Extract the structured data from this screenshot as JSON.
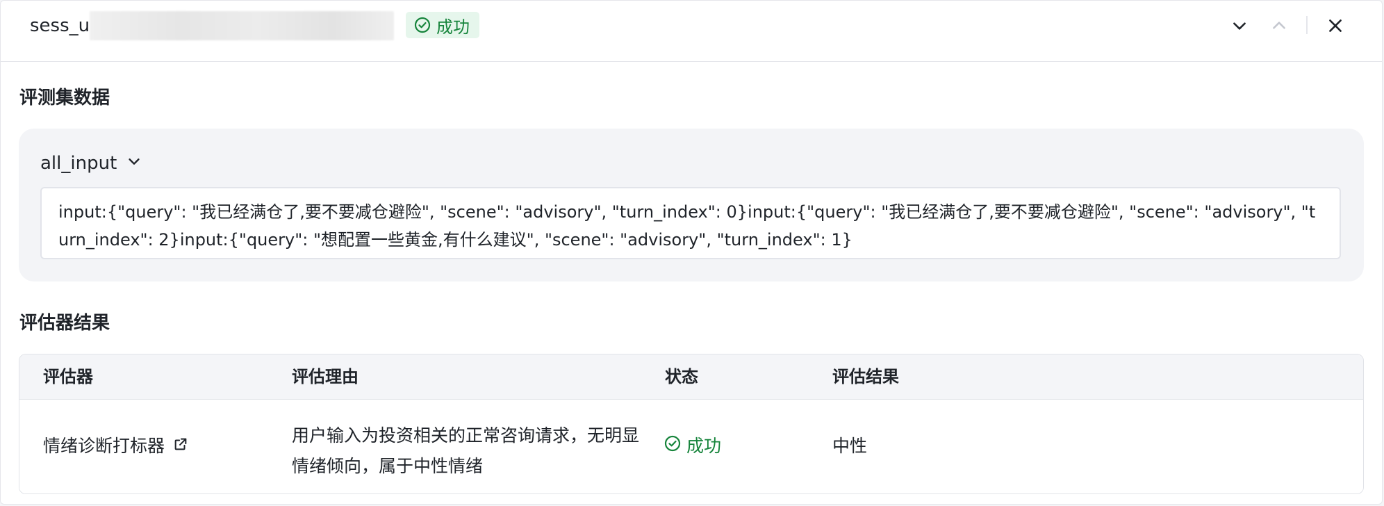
{
  "header": {
    "session_id_prefix": "sess_u",
    "status_badge": "成功",
    "icons": [
      "chevron-down-icon",
      "chevron-up-icon",
      "close-icon"
    ]
  },
  "dataset": {
    "section_title": "评测集数据",
    "field_name": "all_input",
    "field_value": "input:{\"query\": \"我已经满仓了,要不要减仓避险\", \"scene\": \"advisory\", \"turn_index\": 0}input:{\"query\": \"我已经满仓了,要不要减仓避险\", \"scene\": \"advisory\", \"turn_index\": 2}input:{\"query\": \"想配置一些黄金,有什么建议\", \"scene\": \"advisory\", \"turn_index\": 1}"
  },
  "results": {
    "section_title": "评估器结果",
    "columns": [
      "评估器",
      "评估理由",
      "状态",
      "评估结果"
    ],
    "rows": [
      {
        "evaluator": "情绪诊断打标器",
        "reason": "用户输入为投资相关的正常咨询请求，无明显情绪倾向，属于中性情绪",
        "status": "成功",
        "result": "中性"
      }
    ]
  },
  "colors": {
    "success": "#16843b",
    "success_bg": "#e6f6ec",
    "card_bg": "#f3f4f7",
    "border": "#e5e6eb"
  }
}
